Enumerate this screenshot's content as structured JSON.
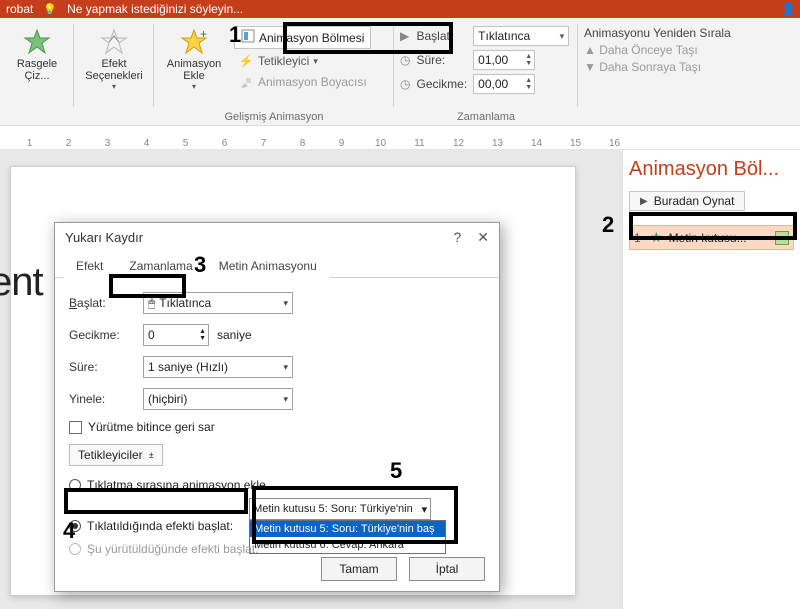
{
  "titlebar": {
    "acrobat": "robat",
    "tell_me": "Ne yapmak istediğinizi söyleyin..."
  },
  "ribbon": {
    "rasgele": "Rasgele Çiz...",
    "efekt_secenekleri": "Efekt Seçenekleri",
    "animasyon_ekle": "Animasyon Ekle",
    "animasyon_bolmesi": "Animasyon Bölmesi",
    "tetikleyici": "Tetikleyici",
    "animasyon_boyacisi": "Animasyon Boyacısı",
    "gelismis_anim": "Gelişmiş Animasyon",
    "baslat_lbl": "Başlat:",
    "baslat_val": "Tıklatınca",
    "sure_lbl": "Süre:",
    "sure_val": "01,00",
    "gecikme_lbl": "Gecikme:",
    "gecikme_val": "00,00",
    "zamanlama": "Zamanlama",
    "yeniden_sirala": "Animasyonu Yeniden Sırala",
    "daha_onceye": "Daha Önceye Taşı",
    "daha_sonraya": "Daha Sonraya Taşı"
  },
  "ruler": [
    "1",
    "2",
    "3",
    "4",
    "5",
    "6",
    "7",
    "8",
    "9",
    "10",
    "11",
    "12",
    "13",
    "14",
    "15",
    "16"
  ],
  "pane": {
    "title": "Animasyon Böl...",
    "play": "Buradan Oynat",
    "item_num": "1",
    "item_text": "Metin kutusu..."
  },
  "slide": {
    "text": "ent"
  },
  "dialog": {
    "title": "Yukarı Kaydır",
    "tab_efekt": "Efekt",
    "tab_zamanlama": "Zamanlama",
    "tab_metin": "Metin Animasyonu",
    "baslat_lbl": "Başlat:",
    "baslat_val": "Tıklatınca",
    "gecikme_lbl": "Gecikme:",
    "gecikme_val": "0",
    "gecikme_unit": "saniye",
    "sure_lbl": "Süre:",
    "sure_val": "1 saniye (Hızlı)",
    "yinele_lbl": "Yinele:",
    "yinele_val": "(hiçbiri)",
    "yurutme_chk": "Yürütme bitince geri sar",
    "tetikleyiciler_btn": "Tetikleyiciler",
    "radio1": "Tıklatma sırasına animasyon ekle",
    "radio2": "Tıklatıldığında efekti başlat:",
    "radio3": "Şu yürütüldüğünde efekti başlat:",
    "trigger_sel": "Metin kutusu 5: Soru: Türkiye'nin",
    "trigger_opt1": "Metin kutusu 5: Soru: Türkiye'nin baş",
    "trigger_opt2": "Metin kutusu 6: Cevap: Ankara",
    "ok": "Tamam",
    "cancel": "İptal"
  },
  "callouts": {
    "c1": "1",
    "c2": "2",
    "c3": "3",
    "c4": "4",
    "c5": "5"
  }
}
